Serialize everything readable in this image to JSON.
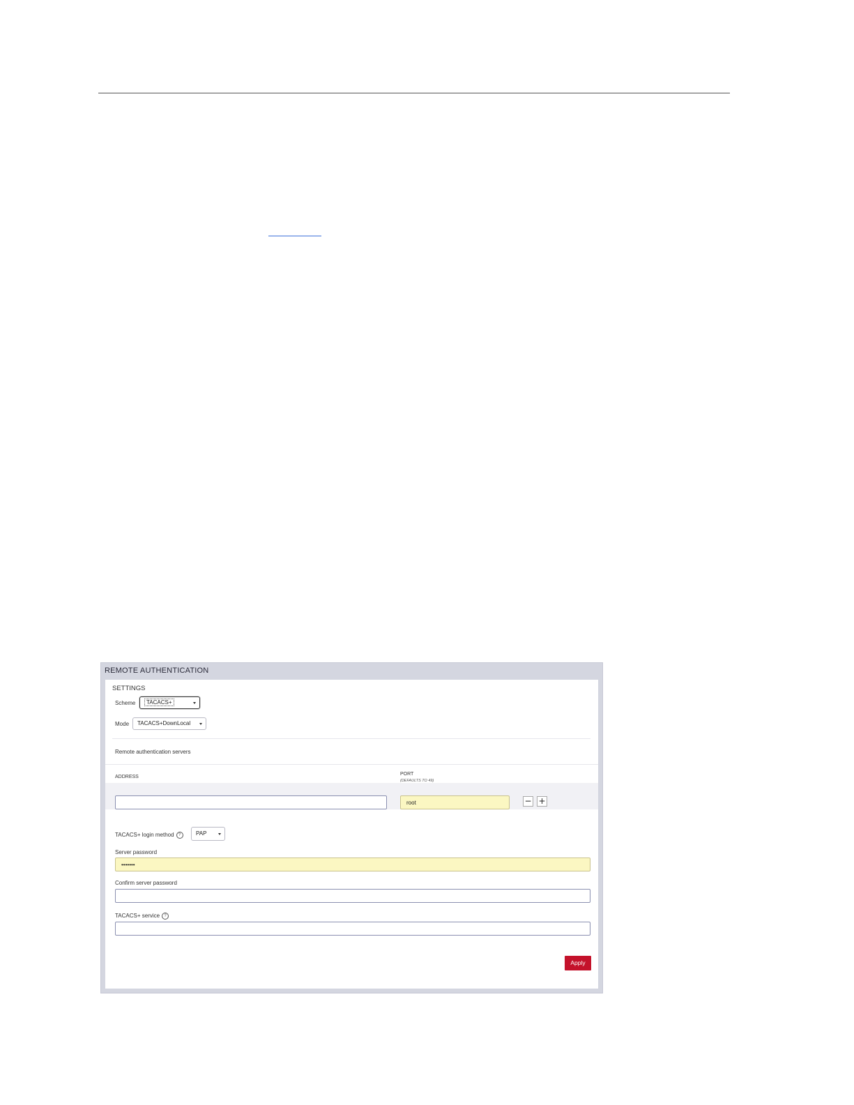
{
  "panel": {
    "title": "REMOTE AUTHENTICATION",
    "settings_title": "SETTINGS"
  },
  "scheme": {
    "label": "Scheme",
    "value": "TACACS+"
  },
  "mode": {
    "label": "Mode",
    "value": "TACACS+DownLocal"
  },
  "servers": {
    "heading": "Remote authentication servers",
    "address_header": "ADDRESS",
    "port_header": "PORT",
    "port_subheader": "(DEFAULTS TO 49)",
    "address_value": "",
    "port_value": "root",
    "remove_label": "−",
    "add_label": "+"
  },
  "login_method": {
    "label": "TACACS+ login method",
    "value": "PAP",
    "help_icon": "?"
  },
  "server_password": {
    "label": "Server password",
    "value": "•••••••"
  },
  "confirm_password": {
    "label": "Confirm server password",
    "value": ""
  },
  "service": {
    "label": "TACACS+ service",
    "value": "",
    "help_icon": "?"
  },
  "apply_label": "Apply",
  "colors": {
    "apply": "#c4122b",
    "autofill": "#fbf7c2",
    "panel_bg": "#d4d6e0"
  }
}
